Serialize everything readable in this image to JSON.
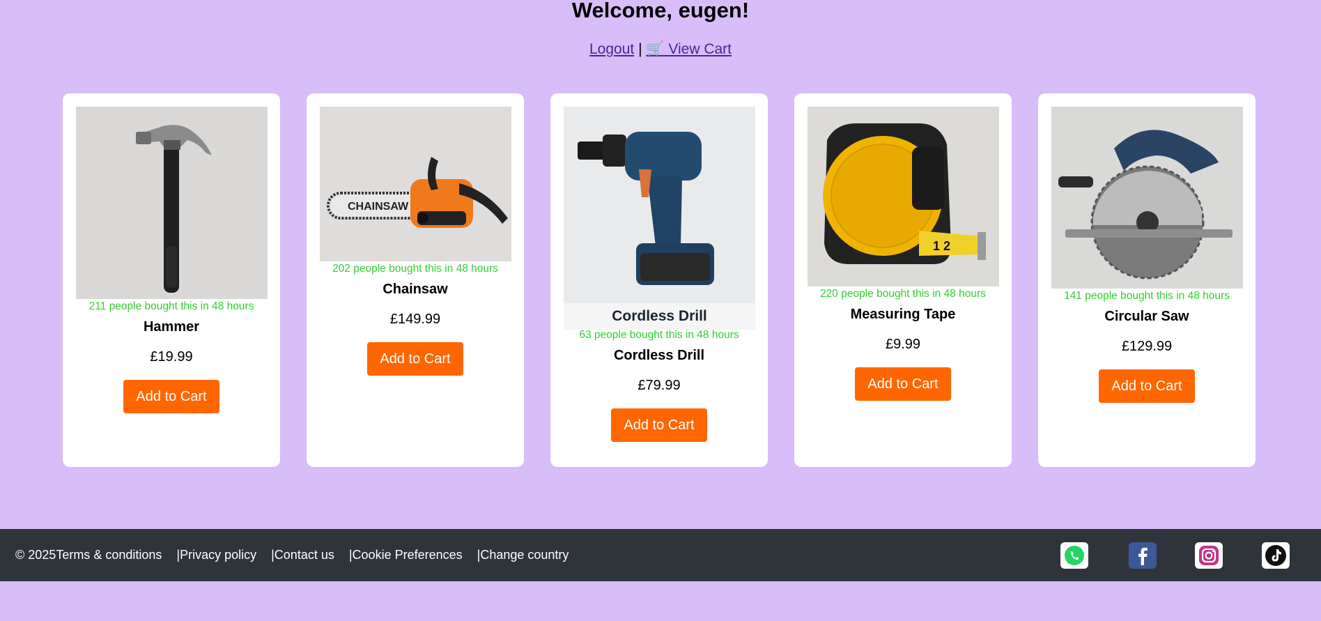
{
  "header": {
    "welcome": "Welcome, eugen!",
    "logout": "Logout",
    "separator": "|",
    "cart_icon": "🛒",
    "view_cart": " View Cart"
  },
  "products": [
    {
      "sold": "211 people bought this in 48 hours",
      "name": "Hammer",
      "price": "£19.99",
      "button": "Add to Cart",
      "image": "hammer-image"
    },
    {
      "sold": "202 people bought this in 48 hours",
      "name": "Chainsaw",
      "price": "£149.99",
      "button": "Add to Cart",
      "image": "chainsaw-image",
      "image_text": "CHAINSAW"
    },
    {
      "sold": "63 people bought this in 48 hours",
      "name": "Cordless Drill",
      "price": "£79.99",
      "button": "Add to Cart",
      "image": "drill-image",
      "image_caption": "Cordless Drill"
    },
    {
      "sold": "220 people bought this in 48 hours",
      "name": "Measuring Tape",
      "price": "£9.99",
      "button": "Add to Cart",
      "image": "tape-image",
      "image_text": "1 2"
    },
    {
      "sold": "141 people bought this in 48 hours",
      "name": "Circular Saw",
      "price": "£129.99",
      "button": "Add to Cart",
      "image": "circular-saw-image"
    }
  ],
  "footer": {
    "copyright": "© 2025",
    "terms": "Terms & conditions",
    "privacy": "|Privacy policy",
    "contact": "|Contact us",
    "cookies": "|Cookie Preferences",
    "country": "|Change country",
    "social": [
      "whatsapp-icon",
      "facebook-icon",
      "instagram-icon",
      "tiktok-icon"
    ]
  },
  "colors": {
    "background": "#d8bdf8",
    "accent": "#ff6600",
    "sold_text": "#33cc33",
    "footer": "#2f343a"
  }
}
